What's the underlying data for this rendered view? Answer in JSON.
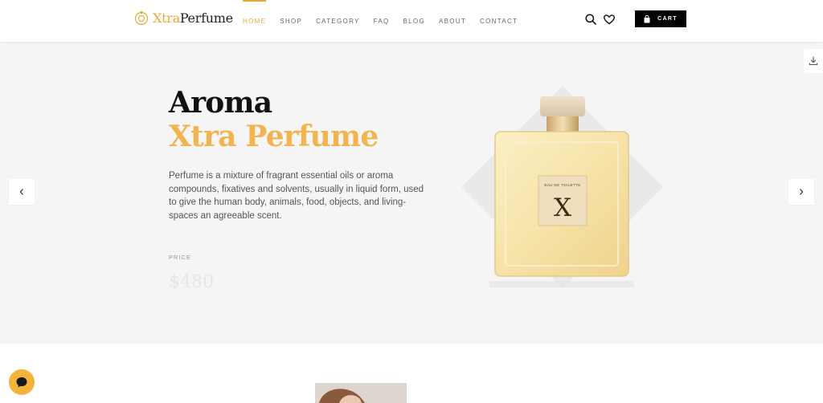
{
  "brand": {
    "name_part1": "Xtra",
    "name_part2": "Perfume",
    "accent": "#e8a93a",
    "icon": "perfume-flower-icon"
  },
  "nav": {
    "items": [
      {
        "label": "HOME",
        "active": true
      },
      {
        "label": "SHOP"
      },
      {
        "label": "CATEGORY"
      },
      {
        "label": "FAQ"
      },
      {
        "label": "BLOG"
      },
      {
        "label": "ABOUT"
      },
      {
        "label": "CONTACT"
      }
    ]
  },
  "header_icons": [
    "search-icon",
    "heart-icon"
  ],
  "cart": {
    "label": "CART",
    "icon": "shopping-bag-icon"
  },
  "hero": {
    "title_line1": "Aroma",
    "title_line2": "Xtra Perfume",
    "title_accent": "#f3b44f",
    "description": "Perfume is a mixture of fragrant essential oils or aroma compounds, fixatives and solvents, usually in liquid form, used to give the human body, animals, food, objects, and living-spaces an agreeable scent.",
    "price_label": "PRICE",
    "price": "$480",
    "product_label_top": "EAU DE TOILETTE",
    "product_label_letter": "X"
  },
  "slider": {
    "prev_icon": "chevron-left-icon",
    "next_icon": "chevron-right-icon"
  },
  "side_tool": {
    "icon": "download-icon"
  },
  "chat": {
    "icon": "chat-bubble-icon",
    "color": "#f2b43b"
  }
}
